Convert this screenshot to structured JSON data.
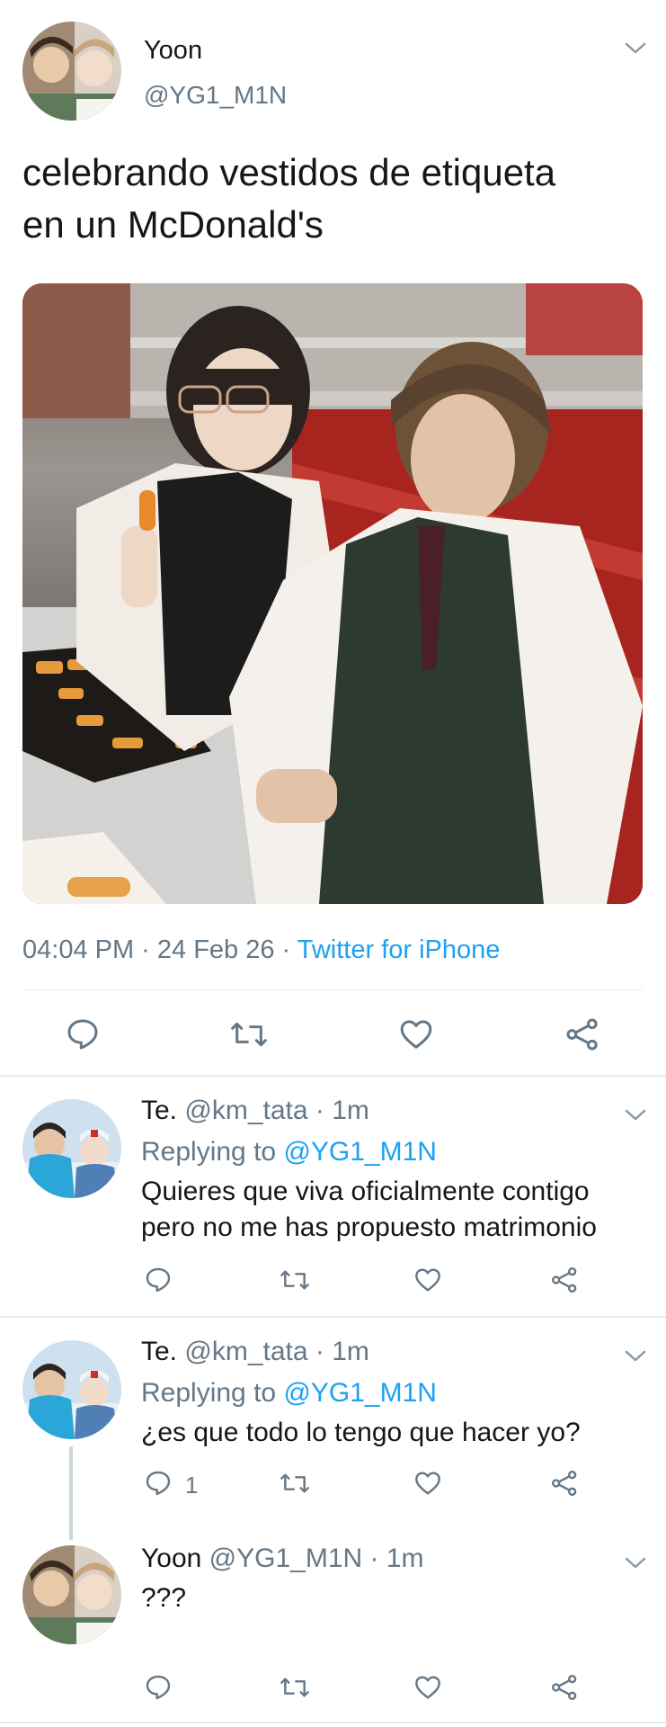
{
  "colors": {
    "accent": "#1da1f2",
    "secondary_text": "#657786",
    "divider": "#e6ecf0"
  },
  "main_tweet": {
    "author_name": "Yoon",
    "author_handle": "@YG1_M1N",
    "text_line1": "celebrando vestidos de etiqueta",
    "text_line2": "en un McDonald's",
    "timestamp": "04:04 PM · 24 Feb 26 · ",
    "source": "Twitter for iPhone",
    "actions": [
      "reply-icon",
      "retweet-icon",
      "like-icon",
      "share-icon"
    ]
  },
  "replies": [
    {
      "name": "Te.",
      "handle": "@km_tata",
      "time": "· 1m",
      "replying_prefix": "Replying to ",
      "replying_to": "@YG1_M1N",
      "text_line1": "Quieres que viva oficialmente contigo",
      "text_line2": "pero no me has propuesto matrimonio",
      "reply_count": ""
    },
    {
      "name": "Te.",
      "handle": "@km_tata",
      "time": "· 1m",
      "replying_prefix": "Replying to ",
      "replying_to": "@YG1_M1N",
      "text_line1": "¿es que todo lo tengo que hacer yo?",
      "reply_count": "1"
    },
    {
      "name": "Yoon",
      "handle": "@YG1_M1N",
      "time": "· 1m",
      "text_line1": "???",
      "reply_count": ""
    }
  ]
}
